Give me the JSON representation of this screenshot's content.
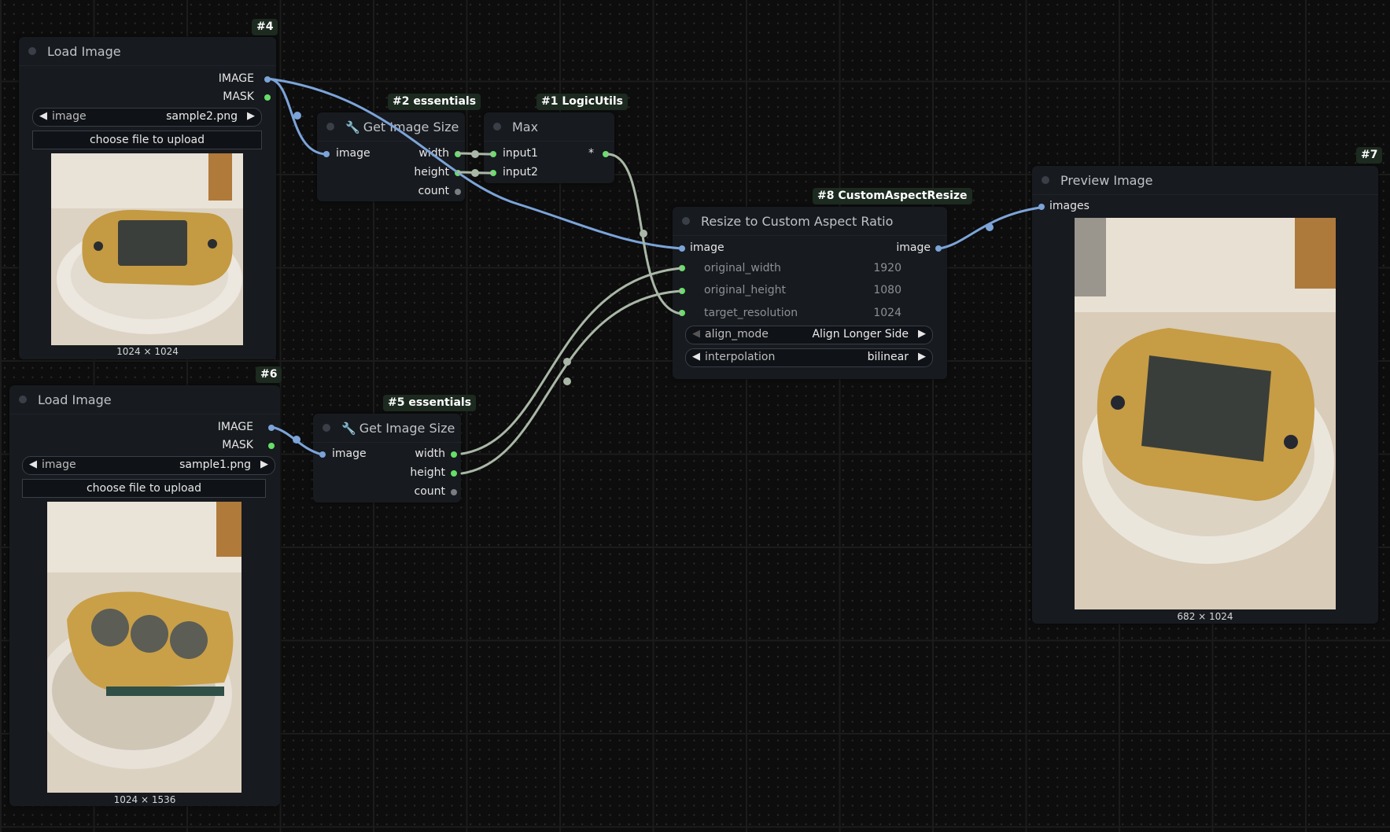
{
  "nodes": {
    "load1": {
      "badge": "#4",
      "title": "Load Image",
      "out_image": "IMAGE",
      "out_mask": "MASK",
      "combo_name": "image",
      "combo_value": "sample2.png",
      "upload": "choose file to upload",
      "caption": "1024 × 1024"
    },
    "load2": {
      "badge": "#6",
      "title": "Load Image",
      "out_image": "IMAGE",
      "out_mask": "MASK",
      "combo_name": "image",
      "combo_value": "sample1.png",
      "upload": "choose file to upload",
      "caption": "1024 × 1536"
    },
    "size1": {
      "badge": "#2 essentials",
      "title": "Get Image Size",
      "in_image": "image",
      "out_width": "width",
      "out_height": "height",
      "out_count": "count"
    },
    "size2": {
      "badge": "#5 essentials",
      "title": "Get Image Size",
      "in_image": "image",
      "out_width": "width",
      "out_height": "height",
      "out_count": "count"
    },
    "max": {
      "badge": "#1 LogicUtils",
      "title": "Max",
      "in1": "input1",
      "in2": "input2",
      "out": "*"
    },
    "resize": {
      "badge": "#8 CustomAspectResize",
      "title": "Resize to Custom Aspect Ratio",
      "in_image": "image",
      "out_image": "image",
      "w_label": "original_width",
      "w_value": "1920",
      "h_label": "original_height",
      "h_value": "1080",
      "t_label": "target_resolution",
      "t_value": "1024",
      "align_name": "align_mode",
      "align_value": "Align Longer Side",
      "interp_name": "interpolation",
      "interp_value": "bilinear"
    },
    "preview": {
      "badge": "#7",
      "title": "Preview Image",
      "in_images": "images",
      "caption": "682 × 1024"
    }
  },
  "colors": {
    "image_link": "#7ca4d9",
    "int_link": "#a9b8a6",
    "int_slot": "#66e066",
    "node_bg": "#171a1f",
    "badge_bg": "#1c2a20"
  },
  "icons": [
    "wrench-icon",
    "arrow-left-icon",
    "arrow-right-icon"
  ]
}
